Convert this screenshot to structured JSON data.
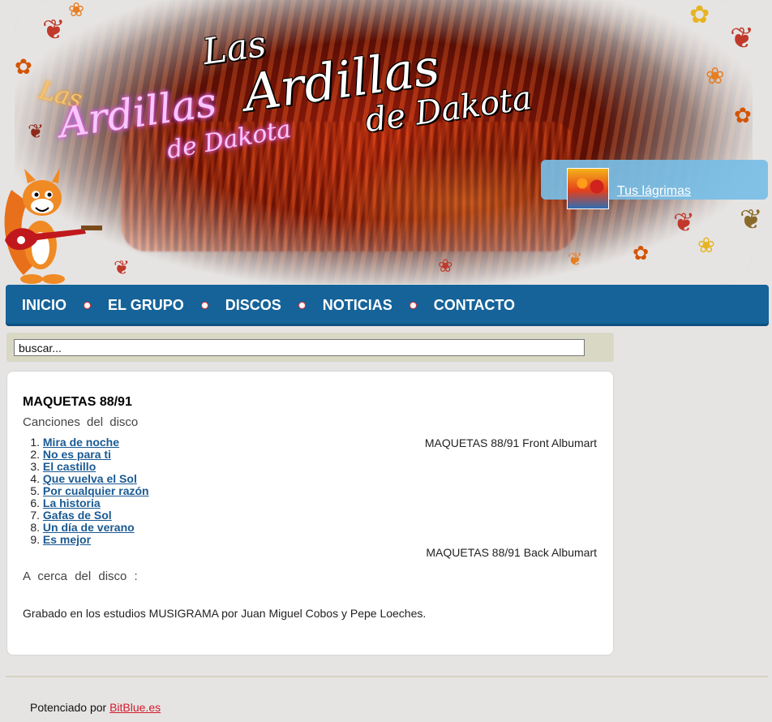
{
  "header": {
    "logo_main": {
      "line1": "Las",
      "line2": "Ardillas",
      "line3": "de Dakota"
    },
    "logo_neon": {
      "line1": "Las",
      "line2": "Ardillas",
      "line3": "de Dakota"
    },
    "promo": {
      "link_label": "Tus lágrimas"
    }
  },
  "nav": {
    "items": [
      {
        "label": "INICIO"
      },
      {
        "label": "EL GRUPO"
      },
      {
        "label": "DISCOS"
      },
      {
        "label": "NOTICIAS"
      },
      {
        "label": "CONTACTO"
      }
    ]
  },
  "search": {
    "value": "buscar..."
  },
  "album": {
    "title": "MAQUETAS 88/91",
    "songs_heading": "Canciones del disco",
    "front_art_alt": "MAQUETAS 88/91 Front Albumart",
    "back_art_alt": "MAQUETAS 88/91 Back Albumart",
    "tracks": [
      {
        "num": "1.",
        "title": "Mira de noche"
      },
      {
        "num": "2.",
        "title": "No es para ti"
      },
      {
        "num": "3.",
        "title": "El castillo"
      },
      {
        "num": "4.",
        "title": "Que vuelva el Sol"
      },
      {
        "num": "5.",
        "title": "Por cualquier razón"
      },
      {
        "num": "6.",
        "title": "La historia"
      },
      {
        "num": "7.",
        "title": "Gafas de Sol"
      },
      {
        "num": "8.",
        "title": "Un día de verano"
      },
      {
        "num": "9.",
        "title": "Es mejor"
      }
    ],
    "about_heading": "A cerca del disco :",
    "about_text": "Grabado en los estudios MUSIGRAMA por Juan Miguel Cobos y Pepe Loeches."
  },
  "footer": {
    "prefix": "Potenciado por",
    "link_label": "BitBlue.es"
  },
  "colors": {
    "nav_bg": "#156399",
    "link": "#1a5a93",
    "footer_link": "#d01c2c",
    "promo_bg": "#78bee6",
    "search_bar_bg": "#d9d8c5"
  }
}
